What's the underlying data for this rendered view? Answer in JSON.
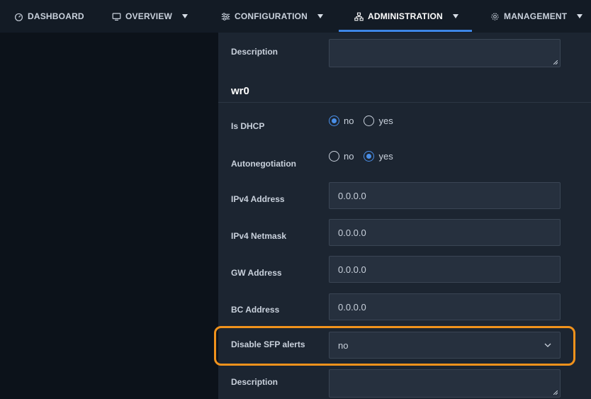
{
  "nav": {
    "items": [
      {
        "label": "DASHBOARD",
        "icon": "dashboard-gauge-icon",
        "has_caret": false
      },
      {
        "label": "OVERVIEW",
        "icon": "monitor-icon",
        "has_caret": true
      },
      {
        "label": "CONFIGURATION",
        "icon": "sliders-icon",
        "has_caret": true
      },
      {
        "label": "ADMINISTRATION",
        "icon": "network-admin-icon",
        "has_caret": true,
        "active": true
      },
      {
        "label": "MANAGEMENT",
        "icon": "gear-icon",
        "has_caret": true
      }
    ]
  },
  "form": {
    "description_top_label": "Description",
    "section_title": "wr0",
    "is_dhcp": {
      "label": "Is DHCP",
      "options": [
        "no",
        "yes"
      ],
      "selected": "no"
    },
    "autonegotiation": {
      "label": "Autonegotiation",
      "options": [
        "no",
        "yes"
      ],
      "selected": "yes"
    },
    "ipv4_address": {
      "label": "IPv4 Address",
      "value": "0.0.0.0"
    },
    "ipv4_netmask": {
      "label": "IPv4 Netmask",
      "value": "0.0.0.0"
    },
    "gw_address": {
      "label": "GW Address",
      "value": "0.0.0.0"
    },
    "bc_address": {
      "label": "BC Address",
      "value": "0.0.0.0"
    },
    "disable_sfp_alerts": {
      "label": "Disable SFP alerts",
      "value": "no"
    },
    "description_bottom_label": "Description"
  },
  "colors": {
    "accent": "#3d86e6",
    "highlight": "#f0921c",
    "background": "#1c2531",
    "sidebar": "#0c121a"
  }
}
